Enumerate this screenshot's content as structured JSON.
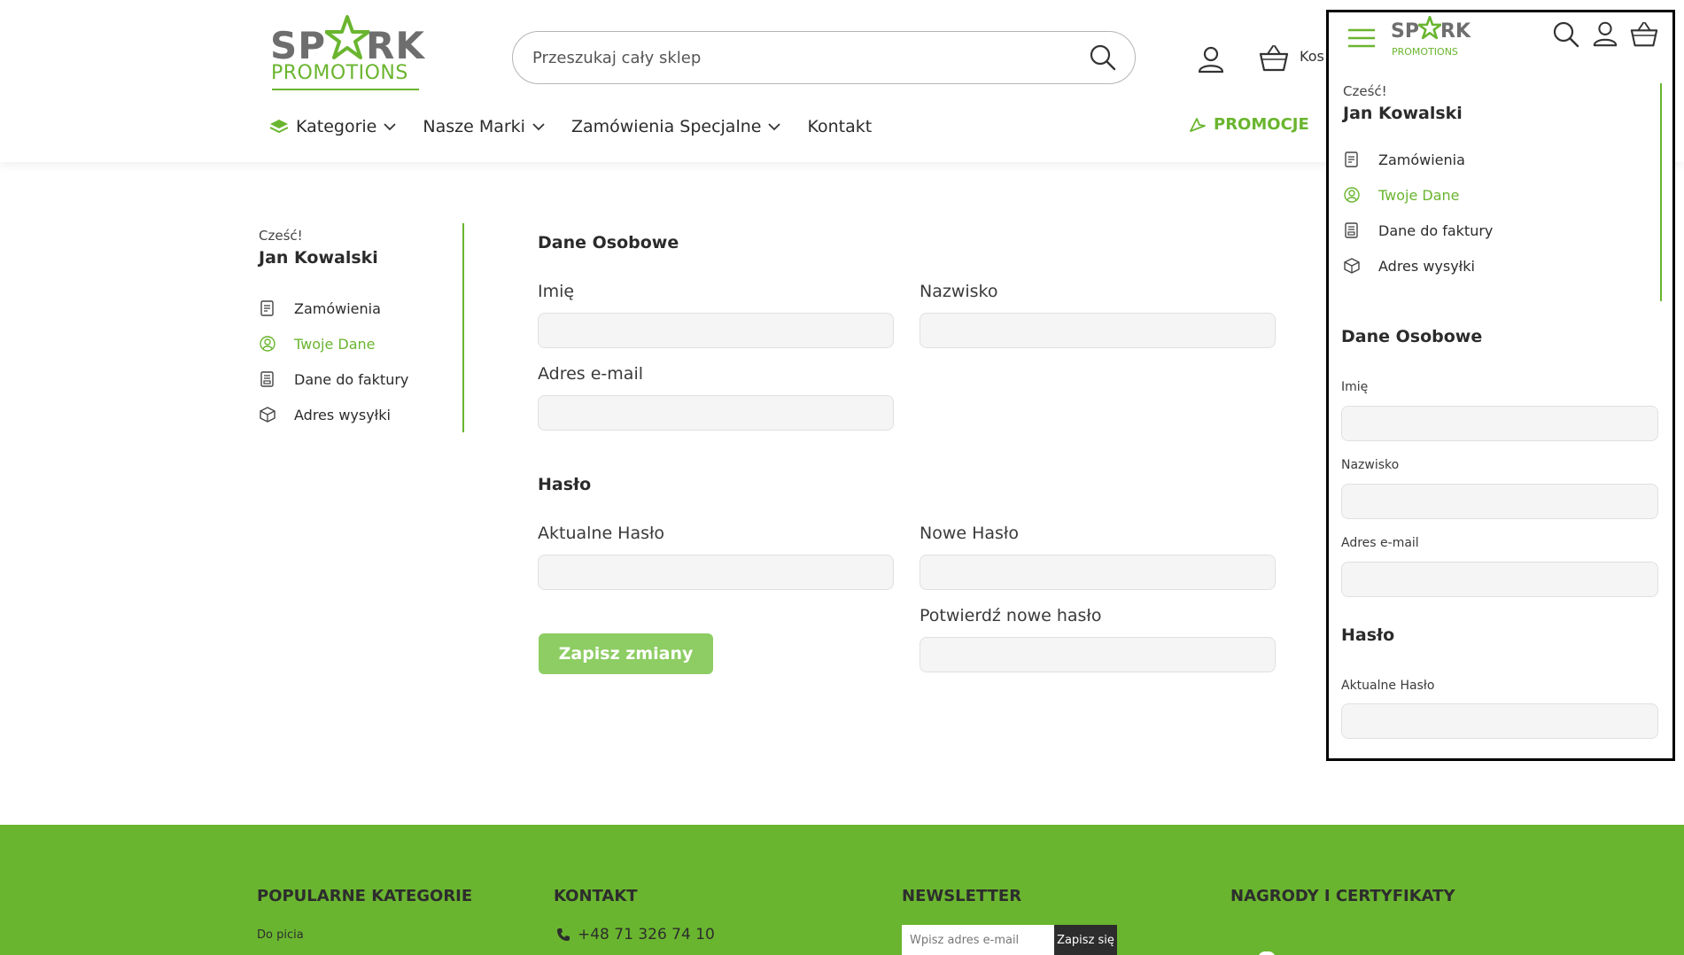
{
  "brand": {
    "logo_text_left": "SP",
    "logo_text_right": "RK",
    "logo_subtitle": "PROMOTIONS",
    "accent": "#6ab52f"
  },
  "search": {
    "placeholder": "Przeszukaj cały sklep",
    "value": ""
  },
  "header": {
    "cart_label": "Kos"
  },
  "nav": {
    "items": [
      {
        "label": "Kategorie",
        "dropdown": true
      },
      {
        "label": "Nasze Marki",
        "dropdown": true
      },
      {
        "label": "Zamówienia Specjalne",
        "dropdown": true
      },
      {
        "label": "Kontakt",
        "dropdown": false
      }
    ],
    "promo_label": "PROMOCJE"
  },
  "account": {
    "greeting": "Cześć!",
    "name": "Jan Kowalski",
    "menu": [
      {
        "label": "Zamówienia",
        "icon": "orders-icon"
      },
      {
        "label": "Twoje Dane",
        "icon": "profile-icon",
        "active": true
      },
      {
        "label": "Dane do faktury",
        "icon": "invoice-icon"
      },
      {
        "label": "Adres wysyłki",
        "icon": "package-icon"
      }
    ]
  },
  "form": {
    "personal_title": "Dane Osobowe",
    "first_name_label": "Imię",
    "last_name_label": "Nazwisko",
    "email_label": "Adres e-mail",
    "password_title": "Hasło",
    "current_password_label": "Aktualne Hasło",
    "new_password_label": "Nowe Hasło",
    "confirm_password_label": "Potwierdź nowe hasło",
    "save_label": "Zapisz zmiany",
    "values": {
      "first_name": "",
      "last_name": "",
      "email": "",
      "current_password": "",
      "new_password": "",
      "confirm_password": ""
    }
  },
  "mobile": {
    "logo_text_left": "SP",
    "logo_text_right": "RK",
    "logo_subtitle": "PROMOTIONS",
    "greeting": "Cześć!",
    "name": "Jan Kowalski",
    "menu": [
      {
        "label": "Zamówienia"
      },
      {
        "label": "Twoje Dane",
        "active": true
      },
      {
        "label": "Dane do faktury"
      },
      {
        "label": "Adres wysyłki"
      }
    ],
    "personal_title": "Dane Osobowe",
    "first_name_label": "Imię",
    "last_name_label": "Nazwisko",
    "email_label": "Adres e-mail",
    "password_title": "Hasło",
    "current_password_label": "Aktualne Hasło"
  },
  "footer": {
    "col1_title": "POPULARNE KATEGORIE",
    "col1_link": "Do picia",
    "col2_title": "KONTAKT",
    "phone": "+48 71 326 74 10",
    "col3_title": "NEWSLETTER",
    "newsletter_placeholder": "Wpisz adres e-mail",
    "newsletter_button": "Zapisz się",
    "col4_title": "NAGRODY I CERTYFIKATY"
  }
}
